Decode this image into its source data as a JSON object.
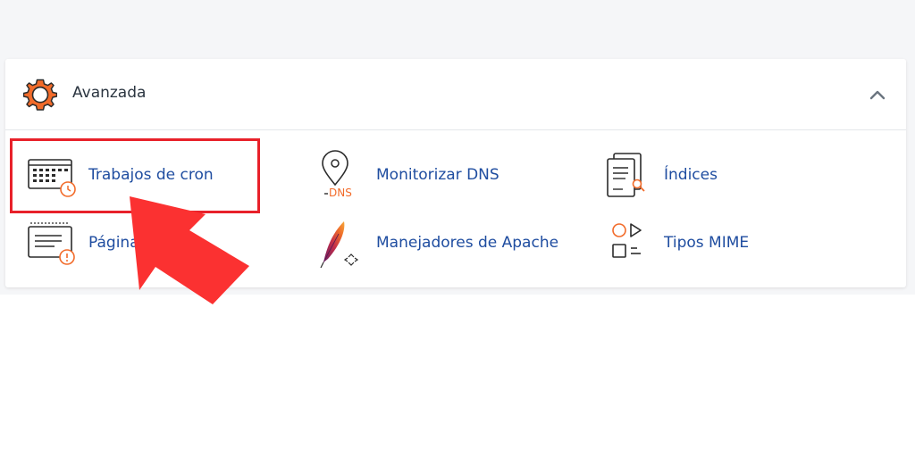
{
  "section": {
    "title": "Avanzada",
    "items": [
      {
        "label": "Trabajos de cron",
        "icon": "calendar-clock-icon"
      },
      {
        "label": "Monitorizar DNS",
        "icon": "location-pin-dns-icon",
        "icon_text": "DNS"
      },
      {
        "label": "Índices",
        "icon": "document-search-icon"
      },
      {
        "label": "Página",
        "icon": "document-alert-icon"
      },
      {
        "label": "Manejadores de Apache",
        "icon": "apache-feather-icon"
      },
      {
        "label": "Tipos MIME",
        "icon": "shapes-icon"
      }
    ]
  },
  "colors": {
    "accent_orange": "#f26b2a",
    "link_blue": "#1f4da0",
    "highlight_red": "#e8212a",
    "arrow_red": "#fb3131"
  }
}
